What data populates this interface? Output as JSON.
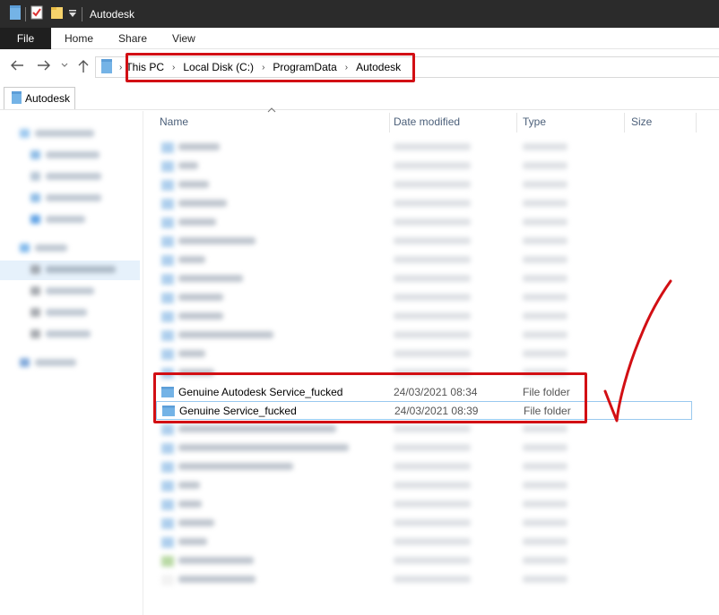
{
  "window": {
    "title": "Autodesk"
  },
  "ribbon": {
    "file": "File",
    "tabs": [
      "Home",
      "Share",
      "View"
    ]
  },
  "address": {
    "crumbs": [
      "This PC",
      "Local Disk (C:)",
      "ProgramData",
      "Autodesk"
    ]
  },
  "location_tab": {
    "label": "Autodesk"
  },
  "columns": {
    "name": "Name",
    "date": "Date modified",
    "type": "Type",
    "size": "Size"
  },
  "highlighted_rows": [
    {
      "name": "Genuine Autodesk Service_fucked",
      "date": "24/03/2021 08:34",
      "type": "File folder"
    },
    {
      "name": "Genuine Service_fucked",
      "date": "24/03/2021 08:39",
      "type": "File folder"
    }
  ],
  "colors": {
    "folder": "#dcb44a",
    "accent": "#d20f14",
    "selection": "#cde3f7"
  }
}
